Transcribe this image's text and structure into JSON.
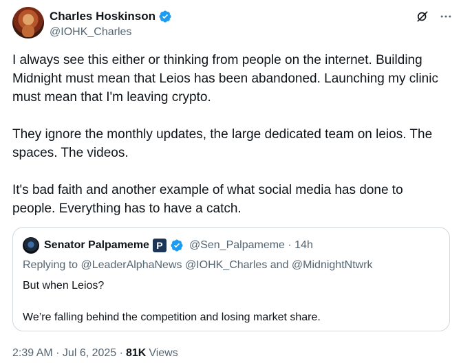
{
  "author": {
    "display_name": "Charles Hoskinson",
    "handle": "@IOHK_Charles"
  },
  "tweet": {
    "text": "I always see this either or thinking from people on the internet. Building Midnight must mean that Leios has been abandoned. Launching my clinic must mean that I'm leaving crypto.\n\nThey ignore the monthly updates, the large dedicated team on leios. The spaces. The videos.\n\nIt's bad faith and another example of what social media has done to people. Everything has to have a catch."
  },
  "quote": {
    "display_name": "Senator Palpameme",
    "badge": "P",
    "handle_time": "@Sen_Palpameme · 14h",
    "replying_prefix": "Replying to ",
    "replying_to": "@LeaderAlphaNews @IOHK_Charles and @MidnightNtwrk",
    "text": "But when Leios?\n\nWe’re falling behind the competition and losing market share."
  },
  "meta": {
    "time_date": "2:39 AM · Jul 6, 2025 ·",
    "views_count": "81K",
    "views_label": "Views"
  },
  "colors": {
    "verified_blue": "#1d9bf0",
    "secondary_text": "#536471",
    "primary_text": "#0f1419",
    "border": "#cfd9de"
  },
  "icons": [
    "verified-badge-icon",
    "grok-icon",
    "more-icon"
  ]
}
